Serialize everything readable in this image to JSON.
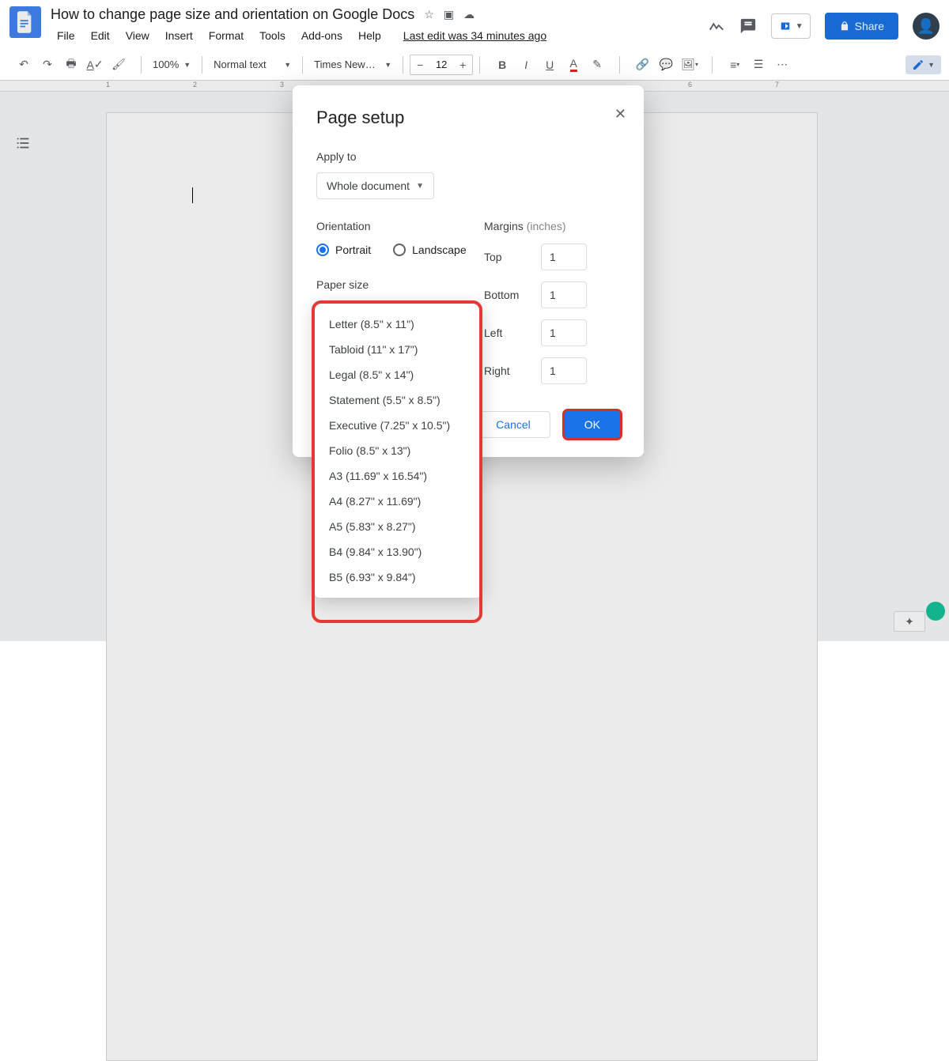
{
  "header": {
    "doc_title": "How to change page size and orientation on Google Docs",
    "menus": [
      "File",
      "Edit",
      "View",
      "Insert",
      "Format",
      "Tools",
      "Add-ons",
      "Help"
    ],
    "last_edit": "Last edit was 34 minutes ago",
    "share_label": "Share"
  },
  "toolbar": {
    "zoom": "100%",
    "style": "Normal text",
    "font": "Times New…",
    "font_size": "12"
  },
  "ruler": {
    "marks": [
      "1",
      "2",
      "3",
      "6",
      "7"
    ]
  },
  "dialog": {
    "title": "Page setup",
    "apply_label": "Apply to",
    "apply_value": "Whole document",
    "orientation_label": "Orientation",
    "orientation_options": {
      "portrait": "Portrait",
      "landscape": "Landscape"
    },
    "paper_label": "Paper size",
    "margins_label": "Margins",
    "margins_unit": "(inches)",
    "margins": {
      "top": {
        "label": "Top",
        "value": "1"
      },
      "bottom": {
        "label": "Bottom",
        "value": "1"
      },
      "left": {
        "label": "Left",
        "value": "1"
      },
      "right": {
        "label": "Right",
        "value": "1"
      }
    },
    "cancel": "Cancel",
    "ok": "OK",
    "paper_options": [
      "Letter (8.5\" x 11\")",
      "Tabloid (11\" x 17\")",
      "Legal (8.5\" x 14\")",
      "Statement (5.5\" x 8.5\")",
      "Executive (7.25\" x 10.5\")",
      "Folio (8.5\" x 13\")",
      "A3 (11.69\" x 16.54\")",
      "A4 (8.27\" x 11.69\")",
      "A5 (5.83\" x 8.27\")",
      "B4 (9.84\" x 13.90\")",
      "B5 (6.93\" x 9.84\")"
    ]
  }
}
